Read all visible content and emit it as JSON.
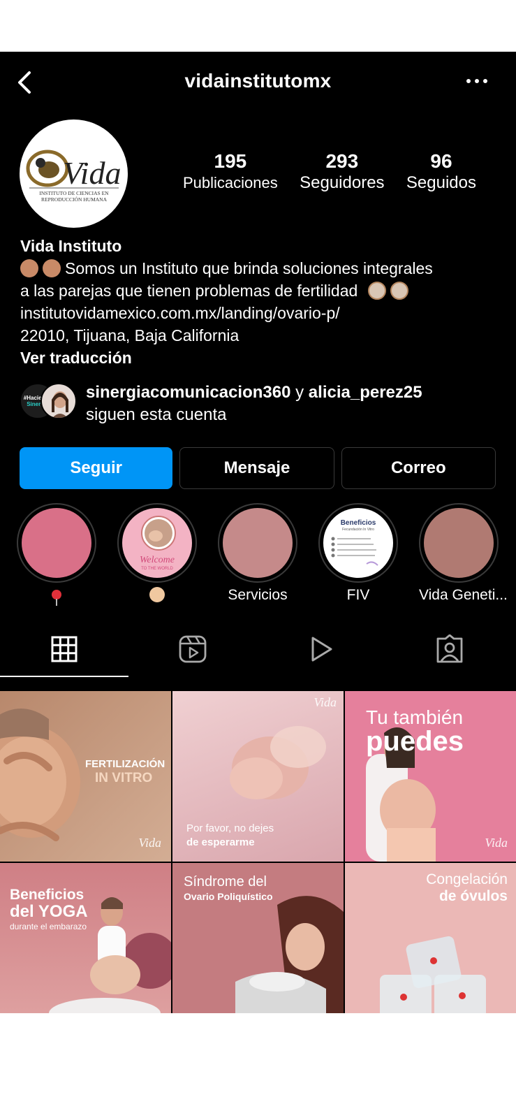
{
  "header": {
    "username": "vidainstitutomx"
  },
  "profile": {
    "avatar_logo_text": "Vida",
    "avatar_logo_sub": "INSTITUTO DE CIENCIAS EN REPRODUCCIÓN HUMANA",
    "stats": [
      {
        "count": "195",
        "label": "Publicaciones"
      },
      {
        "count": "293",
        "label": "Seguidores"
      },
      {
        "count": "96",
        "label": "Seguidos"
      }
    ]
  },
  "bio": {
    "name": "Vida Instituto",
    "line1": "Somos un Instituto que brinda soluciones integrales",
    "line2": "a las parejas que tienen problemas de fertilidad",
    "link": "institutovidamexico.com.mx/landing/ovario-p/",
    "location": "22010, Tijuana, Baja California",
    "translate": "Ver traducción"
  },
  "followed_by": {
    "user1": "sinergiacomunicacion360",
    "conj": "y",
    "user2": "alicia_perez25",
    "suffix": "siguen esta cuenta",
    "avatar1_text": "#Haciendo Sinergia"
  },
  "actions": {
    "follow": "Seguir",
    "message": "Mensaje",
    "email": "Correo"
  },
  "highlights": [
    {
      "label": "",
      "icon": "pin-emoji",
      "color": "#d97088"
    },
    {
      "label": "",
      "icon": "baby-emoji",
      "color": "#f3a9bd",
      "text": "Welcome"
    },
    {
      "label": "Servicios",
      "color": "#c58a8a"
    },
    {
      "label": "FIV",
      "color": "#ffffff",
      "text": "Beneficios"
    },
    {
      "label": "Vida Geneti...",
      "color": "#b07a72"
    }
  ],
  "tabs": [
    "grid-icon",
    "reels-icon",
    "video-icon",
    "tagged-icon"
  ],
  "posts": [
    {
      "line1": "FERTILIZACIÓN",
      "line2": "IN VITRO",
      "logo": "Vida",
      "bg": "#c59a80"
    },
    {
      "line1": "Por favor, no dejes",
      "line2": "de esperarme",
      "logo": "Vida",
      "bg": "#e3bcc0"
    },
    {
      "line1": "Tu también",
      "line2": "puedes",
      "logo": "Vida",
      "bg": "#e3809b"
    },
    {
      "line1": "Beneficios",
      "line2": "del YOGA",
      "line3": "durante el embarazo",
      "bg": "#d68890"
    },
    {
      "line1": "Síndrome del",
      "line2": "Ovario Poliquístico",
      "bg": "#c47c80"
    },
    {
      "line1": "Congelación",
      "line2": "de óvulos",
      "bg": "#eab8b6"
    }
  ]
}
